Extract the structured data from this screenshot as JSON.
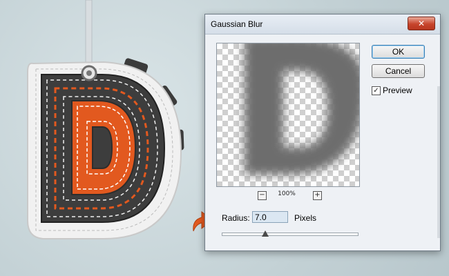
{
  "dialog": {
    "title": "Gaussian Blur",
    "close_icon": "close-icon",
    "ok_label": "OK",
    "cancel_label": "Cancel",
    "preview_label": "Preview",
    "preview_checked": true,
    "zoom_level": "100%",
    "zoom_out_icon": "minus-icon",
    "zoom_in_icon": "plus-icon",
    "radius_label": "Radius:",
    "radius_value": "7.0",
    "radius_unit": "Pixels",
    "slider_level_fraction": 0.32
  },
  "colors": {
    "accent_orange": "#e2591f",
    "leather_dark": "#3a3a3a",
    "close_red": "#c7452c"
  }
}
